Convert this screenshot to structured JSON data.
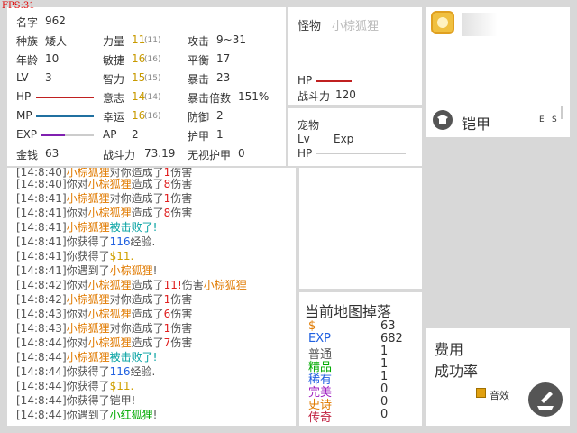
{
  "fps": "FPS:31",
  "stats": {
    "name_label": "名字",
    "name": "962",
    "race_label": "种族",
    "race": "矮人",
    "age_label": "年龄",
    "age": "10",
    "lv_label": "LV",
    "lv": "3",
    "hp_label": "HP",
    "mp_label": "MP",
    "exp_label": "EXP",
    "gold_label": "金钱",
    "gold": "63",
    "str_label": "力量",
    "str": "11",
    "str_base": "(11)",
    "agi_label": "敏捷",
    "agi": "16",
    "agi_base": "(16)",
    "int_label": "智力",
    "int": "15",
    "int_base": "(15)",
    "will_label": "意志",
    "will": "14",
    "will_base": "(14)",
    "luck_label": "幸运",
    "luck": "16",
    "luck_base": "(16)",
    "ap_label": "AP",
    "ap": "2",
    "power_label": "战斗力",
    "power": "73.19",
    "atk_label": "攻击",
    "atk": "9~31",
    "bal_label": "平衡",
    "bal": "17",
    "crit_label": "暴击",
    "crit": "23",
    "critmul_label": "暴击倍数",
    "critmul": "151%",
    "def_label": "防御",
    "def": "2",
    "armor_label": "护甲",
    "armor": "1",
    "ignore_label": "无视护甲",
    "ignore": "0",
    "hp_color": "#c02020",
    "mp_color": "#2070a0",
    "exp_color": "#8020b0"
  },
  "monster": {
    "label": "怪物",
    "name": "小棕狐狸",
    "hp_label": "HP",
    "power_label": "战斗力",
    "power": "120"
  },
  "pet": {
    "label": "宠物",
    "lv_label": "Lv",
    "exp_label": "Exp",
    "hp_label": "HP"
  },
  "equip": {
    "item_name": "铠甲",
    "item_key": "E",
    "item_key2": "S"
  },
  "log": [
    {
      "time": "[14:8:40]",
      "parts": [
        [
          "m",
          "小棕狐狸"
        ],
        [
          "t",
          "对你造成了"
        ],
        [
          "r",
          "1"
        ],
        [
          "t",
          "伤害"
        ]
      ]
    },
    {
      "time": "[14:8:40]",
      "parts": [
        [
          "t",
          "你对"
        ],
        [
          "m",
          "小棕狐狸"
        ],
        [
          "t",
          "造成了"
        ],
        [
          "r",
          "8"
        ],
        [
          "t",
          "伤害"
        ]
      ]
    },
    {
      "time": "[14:8:41]",
      "parts": [
        [
          "m",
          "小棕狐狸"
        ],
        [
          "t",
          "对你造成了"
        ],
        [
          "r",
          "1"
        ],
        [
          "t",
          "伤害"
        ]
      ]
    },
    {
      "time": "[14:8:41]",
      "parts": [
        [
          "t",
          "你对"
        ],
        [
          "m",
          "小棕狐狸"
        ],
        [
          "t",
          "造成了"
        ],
        [
          "r",
          "8"
        ],
        [
          "t",
          "伤害"
        ]
      ]
    },
    {
      "time": "[14:8:41]",
      "parts": [
        [
          "m",
          "小棕狐狸"
        ],
        [
          "c",
          "被击败了!"
        ]
      ]
    },
    {
      "time": "[14:8:41]",
      "parts": [
        [
          "t",
          "你获得了"
        ],
        [
          "b",
          "116"
        ],
        [
          "t",
          "经验."
        ]
      ]
    },
    {
      "time": "[14:8:41]",
      "parts": [
        [
          "t",
          "你获得了"
        ],
        [
          "y",
          "$11."
        ]
      ]
    },
    {
      "time": "[14:8:41]",
      "parts": [
        [
          "t",
          "你遇到了"
        ],
        [
          "m",
          "小棕狐狸"
        ],
        [
          "t",
          "!"
        ]
      ]
    },
    {
      "time": "[14:8:42]",
      "parts": [
        [
          "t",
          "你对"
        ],
        [
          "m",
          "小棕狐狸"
        ],
        [
          "t",
          "造成了"
        ],
        [
          "r",
          "11!"
        ],
        [
          "t",
          "伤害"
        ],
        [
          "m",
          "小棕狐狸"
        ]
      ]
    },
    {
      "time": "[14:8:42]",
      "parts": [
        [
          "m",
          "小棕狐狸"
        ],
        [
          "t",
          "对你造成了"
        ],
        [
          "r",
          "1"
        ],
        [
          "t",
          "伤害"
        ]
      ]
    },
    {
      "time": "[14:8:43]",
      "parts": [
        [
          "t",
          "你对"
        ],
        [
          "m",
          "小棕狐狸"
        ],
        [
          "t",
          "造成了"
        ],
        [
          "r",
          "6"
        ],
        [
          "t",
          "伤害"
        ]
      ]
    },
    {
      "time": "[14:8:43]",
      "parts": [
        [
          "m",
          "小棕狐狸"
        ],
        [
          "t",
          "对你造成了"
        ],
        [
          "r",
          "1"
        ],
        [
          "t",
          "伤害"
        ]
      ]
    },
    {
      "time": "[14:8:44]",
      "parts": [
        [
          "t",
          "你对"
        ],
        [
          "m",
          "小棕狐狸"
        ],
        [
          "t",
          "造成了"
        ],
        [
          "r",
          "7"
        ],
        [
          "t",
          "伤害"
        ]
      ]
    },
    {
      "time": "[14:8:44]",
      "parts": [
        [
          "m",
          "小棕狐狸"
        ],
        [
          "c",
          "被击败了!"
        ]
      ]
    },
    {
      "time": "[14:8:44]",
      "parts": [
        [
          "t",
          "你获得了"
        ],
        [
          "b",
          "116"
        ],
        [
          "t",
          "经验."
        ]
      ]
    },
    {
      "time": "[14:8:44]",
      "parts": [
        [
          "t",
          "你获得了"
        ],
        [
          "y",
          "$11."
        ]
      ]
    },
    {
      "time": "[14:8:44]",
      "parts": [
        [
          "t",
          "你获得了铠甲!"
        ]
      ]
    },
    {
      "time": "[14:8:44]",
      "parts": [
        [
          "t",
          "你遇到了"
        ],
        [
          "g",
          "小红狐狸"
        ],
        [
          "t",
          "!"
        ]
      ]
    }
  ],
  "drops": {
    "title": "当前地图掉落",
    "rows": [
      {
        "label": "$",
        "value": "63",
        "color": "#e07a00"
      },
      {
        "label": "EXP",
        "value": "682",
        "color": "#2060e0"
      },
      {
        "label": "普通",
        "value": "1",
        "color": "#555555"
      },
      {
        "label": "精品",
        "value": "1",
        "color": "#00aa00"
      },
      {
        "label": "稀有",
        "value": "1",
        "color": "#2060e0"
      },
      {
        "label": "完美",
        "value": "0",
        "color": "#a020c0"
      },
      {
        "label": "史诗",
        "value": "0",
        "color": "#e07a00"
      },
      {
        "label": "传奇",
        "value": "0",
        "color": "#c02040"
      }
    ]
  },
  "craft": {
    "cost_label": "费用",
    "rate_label": "成功率",
    "sound_label": "音效"
  }
}
